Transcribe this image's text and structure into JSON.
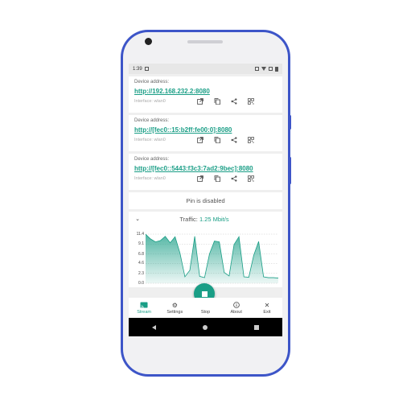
{
  "status_bar": {
    "time": "1:39"
  },
  "devices": [
    {
      "label": "Device address:",
      "address": "http://192.168.232.2:8080",
      "interface": "Interface: wlan0"
    },
    {
      "label": "Device address:",
      "address": "http://[fec0::15:b2ff:fe00:0]:8080",
      "interface": "Interface: wlan0"
    },
    {
      "label": "Device address:",
      "address": "http://[fec0::5443:f3c3:7ad2:9bec]:8080",
      "interface": "Interface: wlan0"
    }
  ],
  "pin_status": "Pin is disabled",
  "traffic": {
    "label": "Traffic:",
    "value": "1.25 Mbit/s"
  },
  "chart_data": {
    "type": "area",
    "y_ticks": [
      "11.4",
      "9.1",
      "6.8",
      "4.6",
      "2.3",
      "0.0"
    ],
    "ylim": [
      0,
      11.4
    ],
    "values": [
      11.4,
      10.3,
      9.6,
      9.9,
      10.9,
      9.4,
      10.8,
      7.0,
      1.5,
      3.0,
      10.9,
      1.6,
      1.3,
      6.8,
      9.8,
      9.6,
      2.5,
      1.7,
      9.0,
      10.8,
      1.5,
      1.4,
      6.5,
      9.7,
      1.5,
      1.3,
      1.3,
      1.2
    ],
    "color": "#1a9e86"
  },
  "fab_icon": "stop-icon",
  "bottom_nav": [
    {
      "label": "Stream",
      "icon": "cast-icon",
      "active": true
    },
    {
      "label": "Settings",
      "icon": "gear-icon",
      "active": false
    },
    {
      "label": "Stop",
      "icon": "stop-icon",
      "active": false
    },
    {
      "label": "About",
      "icon": "info-icon",
      "active": false
    },
    {
      "label": "Exit",
      "icon": "close-icon",
      "active": false
    }
  ]
}
